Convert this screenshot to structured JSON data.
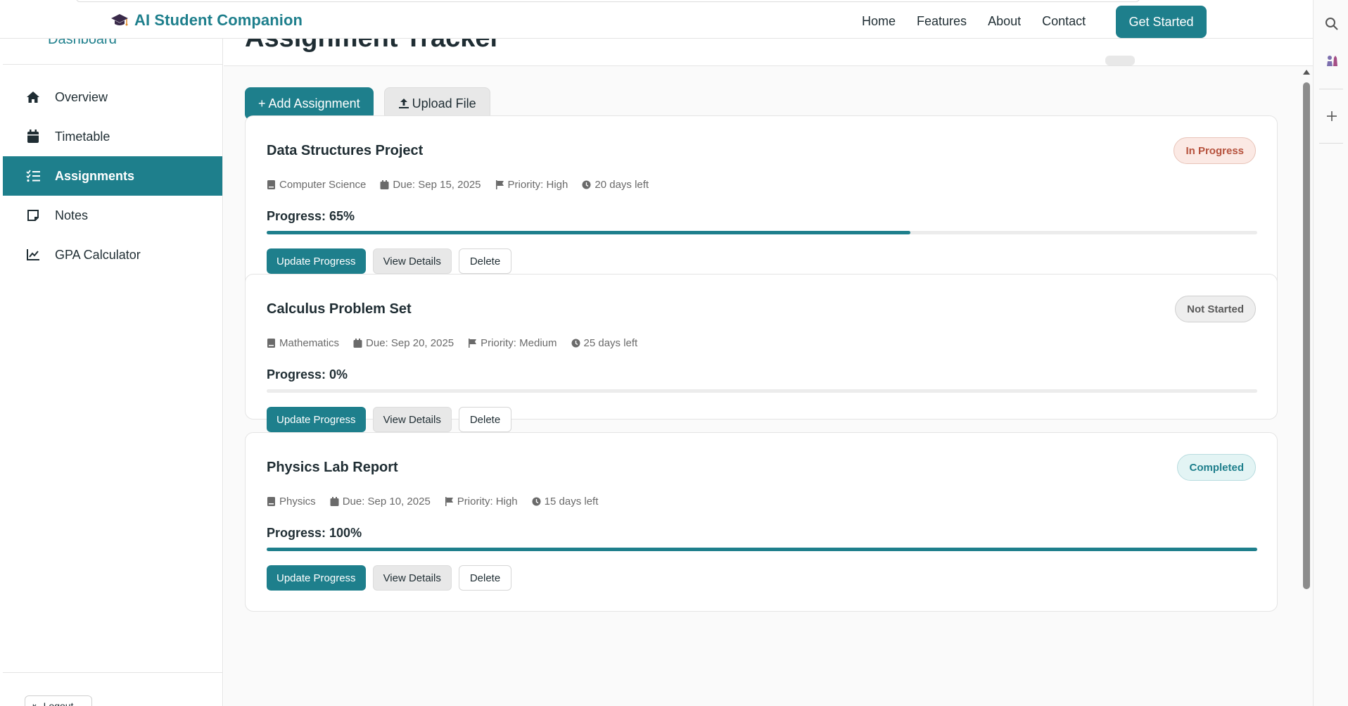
{
  "brand": {
    "name": "AI Student Companion"
  },
  "nav": {
    "links": [
      "Home",
      "Features",
      "About",
      "Contact"
    ],
    "cta": "Get Started"
  },
  "sidebar": {
    "header": "Dashboard",
    "items": [
      {
        "label": "Overview",
        "icon": "home-icon"
      },
      {
        "label": "Timetable",
        "icon": "calendar-icon"
      },
      {
        "label": "Assignments",
        "icon": "checklist-icon",
        "active": true
      },
      {
        "label": "Notes",
        "icon": "note-icon"
      },
      {
        "label": "GPA Calculator",
        "icon": "chart-line-icon"
      }
    ],
    "logout": "Logout"
  },
  "page": {
    "title": "Assignment Tracker",
    "add_label": "Add Assignment",
    "upload_label": "Upload File"
  },
  "assignments": [
    {
      "title": "Data Structures Project",
      "status": "In Progress",
      "subject": "Computer Science",
      "due": "Due: Sep 15, 2025",
      "priority": "Priority: High",
      "days_left": "20 days left",
      "progress_label": "Progress: 65%",
      "progress": 65
    },
    {
      "title": "Calculus Problem Set",
      "status": "Not Started",
      "subject": "Mathematics",
      "due": "Due: Sep 20, 2025",
      "priority": "Priority: Medium",
      "days_left": "25 days left",
      "progress_label": "Progress: 0%",
      "progress": 0
    },
    {
      "title": "Physics Lab Report",
      "status": "Completed",
      "subject": "Physics",
      "due": "Due: Sep 10, 2025",
      "priority": "Priority: High",
      "days_left": "15 days left",
      "progress_label": "Progress: 100%",
      "progress": 100
    }
  ],
  "card_actions": {
    "update": "Update Progress",
    "details": "View Details",
    "delete": "Delete"
  },
  "colors": {
    "accent": "#1e7f8c",
    "in_progress": "#b6523d",
    "not_started": "#5a5a5a",
    "completed": "#1e7f8c"
  }
}
